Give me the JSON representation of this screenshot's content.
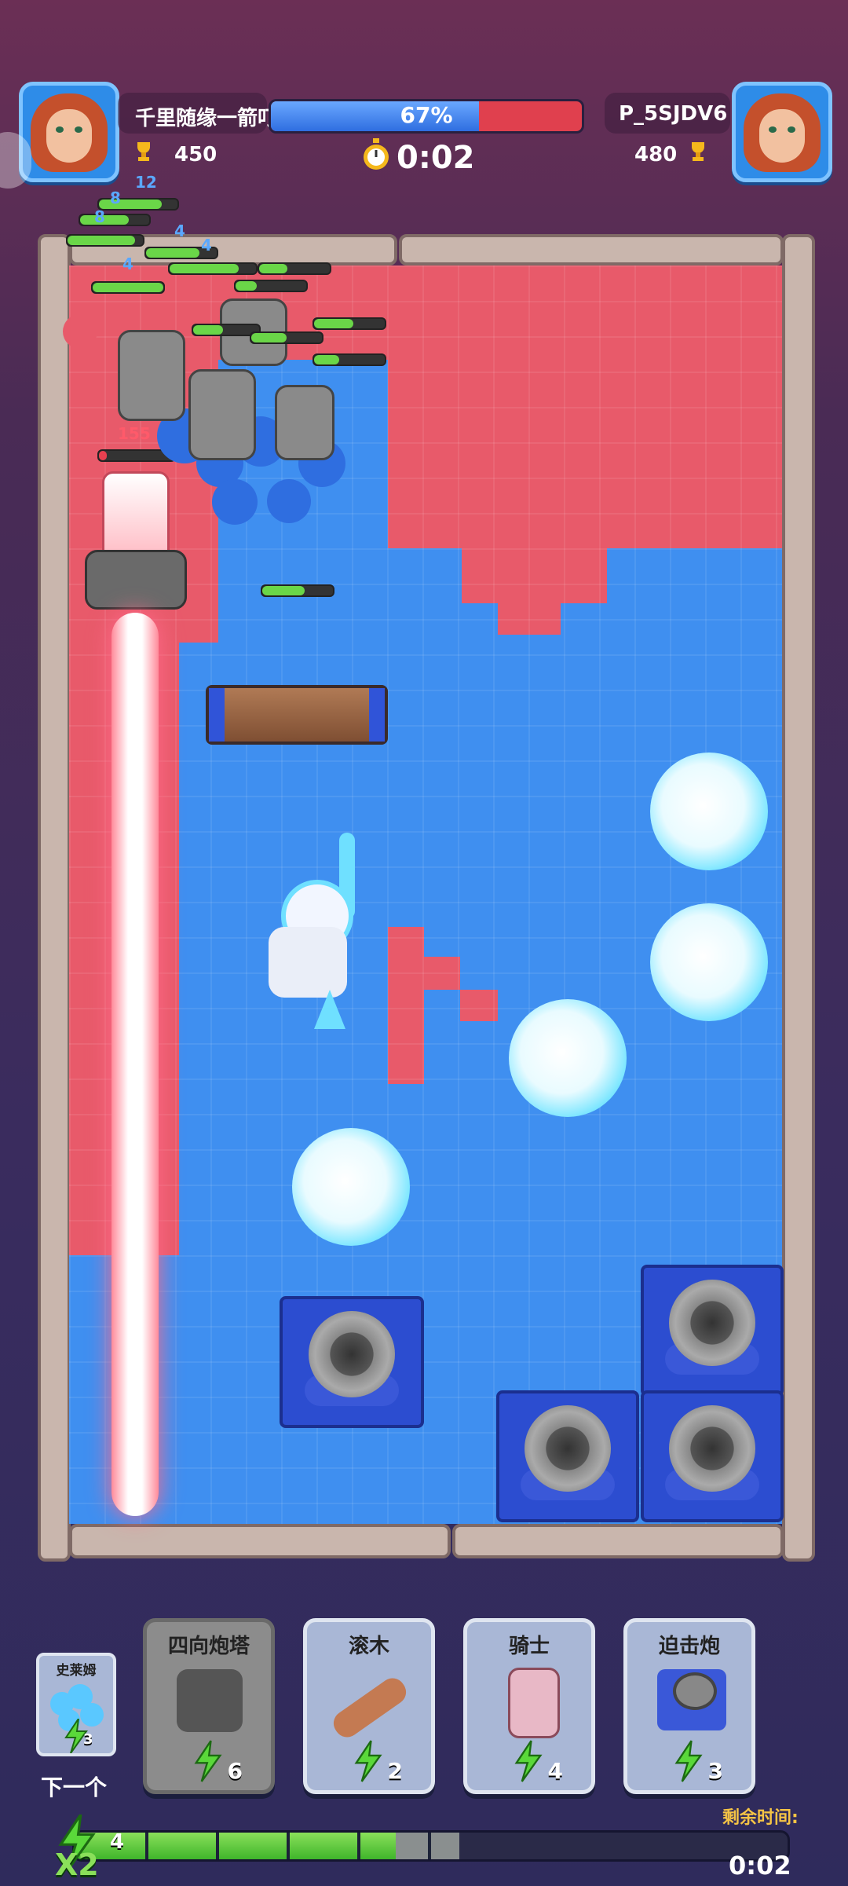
{
  "hud": {
    "player_name": "千里随缘一箭叮",
    "player_trophies": "450",
    "player_level": "12",
    "opponent_name": "P_5SJDV6",
    "opponent_trophies": "480",
    "progress_label": "67%",
    "progress_value": 0.67,
    "timer": "0:02"
  },
  "battlefield": {
    "tower_hp": "155",
    "unit_levels": [
      "8",
      "8",
      "4",
      "4",
      "4"
    ]
  },
  "next_card": {
    "name": "史莱姆",
    "cost": "3",
    "label": "下一个"
  },
  "cards": [
    {
      "name": "四向炮塔",
      "cost": "6",
      "available": false
    },
    {
      "name": "滚木",
      "cost": "2",
      "available": true
    },
    {
      "name": "骑士",
      "cost": "4",
      "available": true
    },
    {
      "name": "迫击炮",
      "cost": "3",
      "available": true
    }
  ],
  "elixir": {
    "count": "4",
    "multiplier": "X2",
    "fill_fraction": 0.45,
    "remaining_time_label": "剩余时间:",
    "remaining_time": "0:02"
  },
  "colors": {
    "blue_team": "#3f8ff0",
    "red_team": "#e85a6a",
    "elixir": "#6ad648"
  }
}
